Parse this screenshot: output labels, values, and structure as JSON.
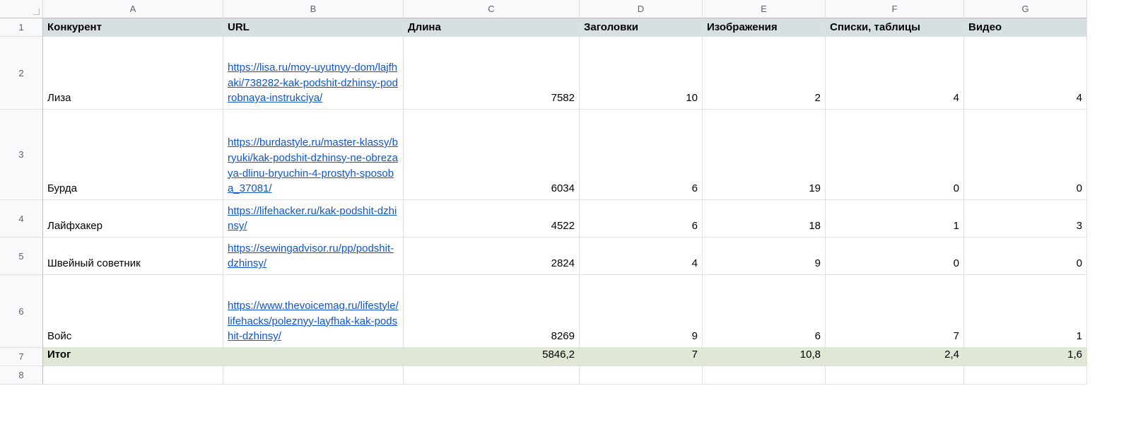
{
  "columns": [
    "A",
    "B",
    "C",
    "D",
    "E",
    "F",
    "G"
  ],
  "rows": [
    "1",
    "2",
    "3",
    "4",
    "5",
    "6",
    "7",
    "8"
  ],
  "headers": {
    "a": "Конкурент",
    "b": "URL",
    "c": "Длина",
    "d": "Заголовки",
    "e": "Изображения",
    "f": "Списки, таблицы",
    "g": "Видео"
  },
  "data": {
    "r2": {
      "a": "Лиза",
      "b": "https://lisa.ru/moy-uyutnyy-dom/lajfhaki/738282-kak-podshit-dzhinsy-podrobnaya-instrukciya/",
      "c": "7582",
      "d": "10",
      "e": "2",
      "f": "4",
      "g": "4"
    },
    "r3": {
      "a": "Бурда",
      "b": "https://burdastyle.ru/master-klassy/bryuki/kak-podshit-dzhinsy-ne-obrezaya-dlinu-bryuchin-4-prostyh-sposoba_37081/",
      "c": "6034",
      "d": "6",
      "e": "19",
      "f": "0",
      "g": "0"
    },
    "r4": {
      "a": "Лайфхакер",
      "b": "https://lifehacker.ru/kak-podshit-dzhinsy/",
      "c": "4522",
      "d": "6",
      "e": "18",
      "f": "1",
      "g": "3"
    },
    "r5": {
      "a": "Швейный советник",
      "b": "https://sewingadvisor.ru/pp/podshit-dzhinsy/",
      "c": "2824",
      "d": "4",
      "e": "9",
      "f": "0",
      "g": "0"
    },
    "r6": {
      "a": "Войс",
      "b": "https://www.thevoicemag.ru/lifestyle/lifehacks/poleznyy-layfhak-kak-podshit-dzhinsy/",
      "c": "8269",
      "d": "9",
      "e": "6",
      "f": "7",
      "g": "1"
    },
    "r7": {
      "a": "Итог",
      "c": "5846,2",
      "d": "7",
      "e": "10,8",
      "f": "2,4",
      "g": "1,6"
    }
  }
}
